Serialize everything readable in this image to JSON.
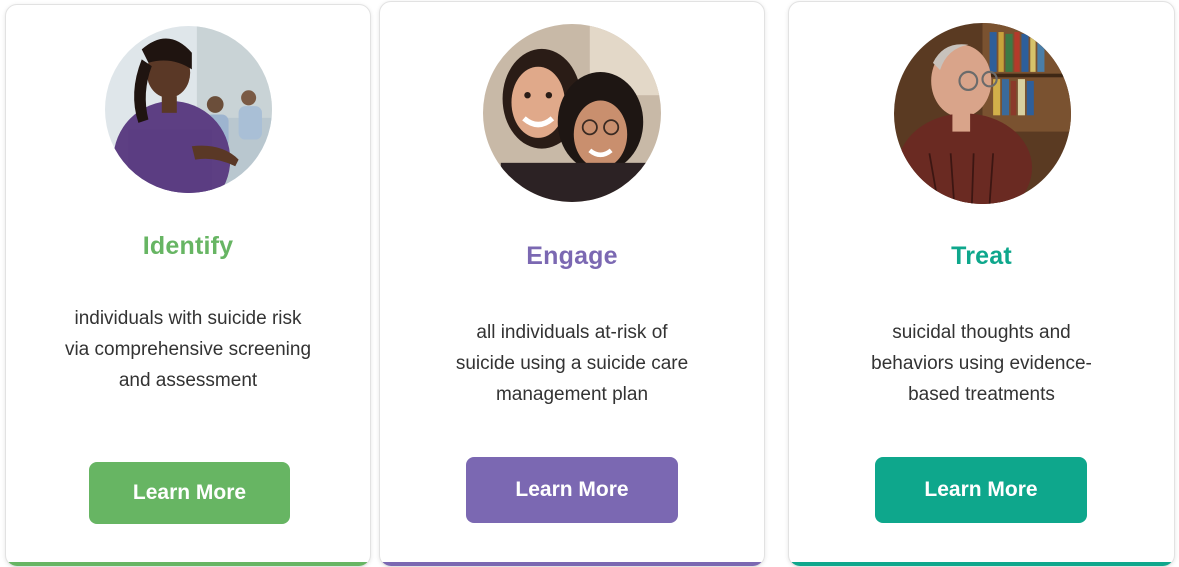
{
  "colors": {
    "identify": "#67b563",
    "engage": "#7b68b2",
    "treat": "#0ea78c"
  },
  "cards": [
    {
      "title": "Identify",
      "description_lines": [
        "individuals with suicide risk",
        "via comprehensive screening",
        "and assessment"
      ],
      "button_label": "Learn More",
      "image": "nurse-with-patients-photo"
    },
    {
      "title": "Engage",
      "description_lines": [
        "all individuals at-risk of",
        "suicide using a suicide care",
        "management plan"
      ],
      "button_label": "Learn More",
      "image": "two-women-smiling-photo"
    },
    {
      "title": "Treat",
      "description_lines": [
        "suicidal thoughts and",
        "behaviors using evidence-",
        "based treatments"
      ],
      "button_label": "Learn More",
      "image": "older-man-with-bookshelf-photo"
    }
  ]
}
